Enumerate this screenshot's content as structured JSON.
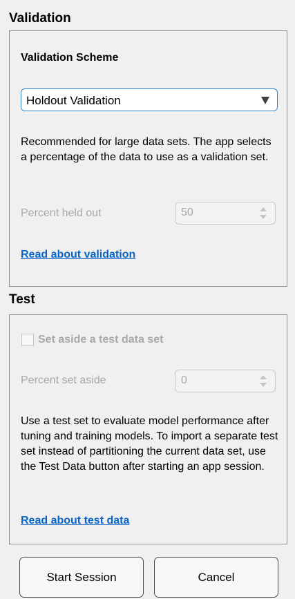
{
  "validation": {
    "title": "Validation",
    "scheme_label": "Validation Scheme",
    "scheme_value": "Holdout Validation",
    "description": "Recommended for large data sets. The app selects a percentage of the data to use as a validation set.",
    "percent_label": "Percent held out",
    "percent_value": "50",
    "link": "Read about validation"
  },
  "test": {
    "title": "Test",
    "checkbox_label": "Set aside a test data set",
    "checkbox_checked": false,
    "percent_label": "Percent set aside",
    "percent_value": "0",
    "description": "Use a test set to evaluate model performance after tuning and training models. To import a separate test set instead of partitioning the current data set, use the Test Data button after starting an app session.",
    "link": "Read about test data"
  },
  "buttons": {
    "start": "Start Session",
    "cancel": "Cancel"
  }
}
